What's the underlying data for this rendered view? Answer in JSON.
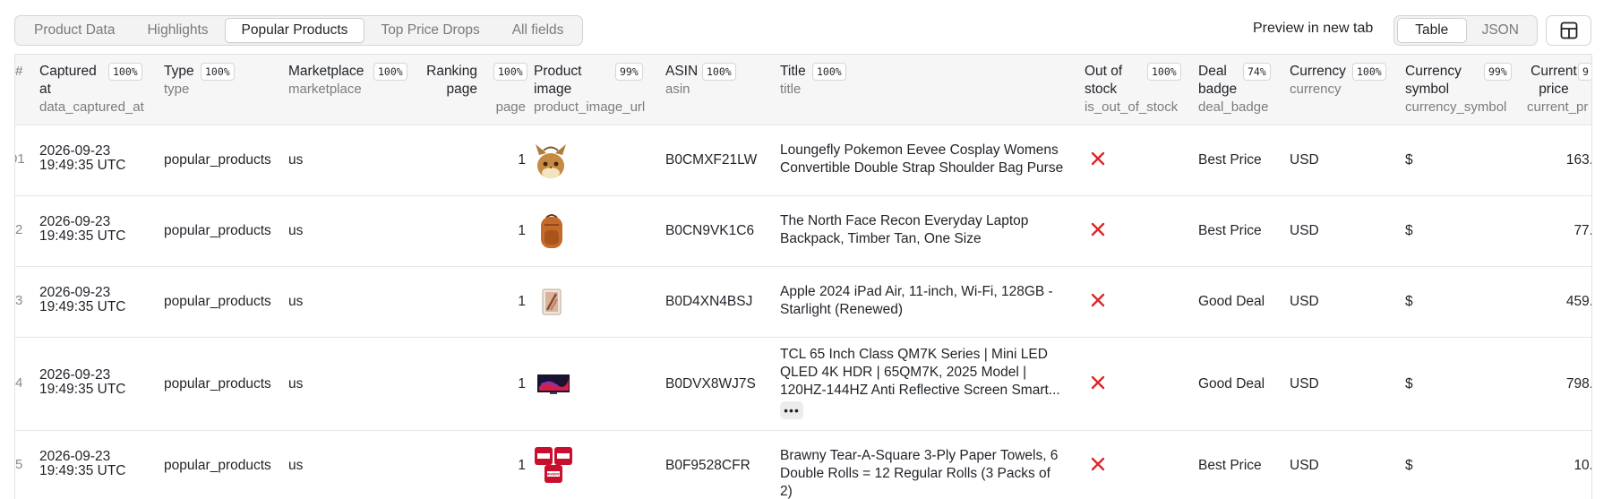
{
  "tabs": [
    {
      "label": "Product Data",
      "active": false
    },
    {
      "label": "Highlights",
      "active": false
    },
    {
      "label": "Popular Products",
      "active": true
    },
    {
      "label": "Top Price Drops",
      "active": false
    },
    {
      "label": "All fields",
      "active": false
    }
  ],
  "preview": {
    "label": "Preview in new tab"
  },
  "view_toggle": {
    "table": "Table",
    "json": "JSON",
    "active": "Table"
  },
  "layout_icon": "layout-panel-icon",
  "table": {
    "rownum_header": "#",
    "columns": [
      {
        "name": "Captured at",
        "key": "data_captured_at",
        "fill": "100%"
      },
      {
        "name": "Type",
        "key": "type",
        "fill": "100%"
      },
      {
        "name": "Marketplace",
        "key": "marketplace",
        "fill": "100%"
      },
      {
        "name": "Ranking page",
        "key": "page",
        "fill": "100%"
      },
      {
        "name": "Product image",
        "key": "product_image_url",
        "fill": "99%"
      },
      {
        "name": "ASIN",
        "key": "asin",
        "fill": "100%"
      },
      {
        "name": "Title",
        "key": "title",
        "fill": "100%"
      },
      {
        "name": "Out of stock",
        "key": "is_out_of_stock",
        "fill": "100%"
      },
      {
        "name": "Deal badge",
        "key": "deal_badge",
        "fill": "74%"
      },
      {
        "name": "Currency",
        "key": "currency",
        "fill": "100%"
      },
      {
        "name": "Currency symbol",
        "key": "currency_symbol",
        "fill": "99%"
      },
      {
        "name": "Current price",
        "key": "current_pr",
        "fill": "9"
      }
    ],
    "rows": [
      {
        "num": "01",
        "captured": "2026-09-23 19:49:35 UTC",
        "type": "popular_products",
        "marketplace": "us",
        "page": "1",
        "image": "eevee-bag-image",
        "asin": "B0CMXF21LW",
        "title": "Loungefly Pokemon Eevee Cosplay Womens Convertible Double Strap Shoulder Bag Purse",
        "out_of_stock": false,
        "deal": "Best Price",
        "currency": "USD",
        "symbol": "$",
        "price": "163."
      },
      {
        "num": "2",
        "captured": "2026-09-23 19:49:35 UTC",
        "type": "popular_products",
        "marketplace": "us",
        "page": "1",
        "image": "backpack-image",
        "asin": "B0CN9VK1C6",
        "title": "The North Face Recon Everyday Laptop Backpack, Timber Tan, One Size",
        "out_of_stock": false,
        "deal": "Best Price",
        "currency": "USD",
        "symbol": "$",
        "price": "77."
      },
      {
        "num": "3",
        "captured": "2026-09-23 19:49:35 UTC",
        "type": "popular_products",
        "marketplace": "us",
        "page": "1",
        "image": "ipad-image",
        "asin": "B0D4XN4BSJ",
        "title": "Apple 2024 iPad Air, 11-inch, Wi-Fi, 128GB - Starlight (Renewed)",
        "out_of_stock": false,
        "deal": "Good Deal",
        "currency": "USD",
        "symbol": "$",
        "price": "459."
      },
      {
        "num": "4",
        "captured": "2026-09-23 19:49:35 UTC",
        "type": "popular_products",
        "marketplace": "us",
        "page": "1",
        "image": "tv-image",
        "asin": "B0DVX8WJ7S",
        "title": "TCL 65 Inch Class QM7K Series | Mini LED QLED 4K HDR | 65QM7K, 2025 Model | 120HZ-144HZ Anti Reflective Screen Smart...",
        "title_more": "•••",
        "out_of_stock": false,
        "deal": "Good Deal",
        "currency": "USD",
        "symbol": "$",
        "price": "798."
      },
      {
        "num": "5",
        "captured": "2026-09-23 19:49:35 UTC",
        "type": "popular_products",
        "marketplace": "us",
        "page": "1",
        "image": "paper-towels-image",
        "asin": "B0F9528CFR",
        "title": "Brawny Tear-A-Square 3-Ply Paper Towels, 6 Double Rolls = 12 Regular Rolls (3 Packs of 2)",
        "out_of_stock": false,
        "deal": "Best Price",
        "currency": "USD",
        "symbol": "$",
        "price": "10."
      }
    ],
    "thumb_labels": {
      "paper_towels": "BRAWNY"
    }
  },
  "colors": {
    "x_mark": "#e02424",
    "border": "#e3e3e3",
    "header_bg": "#f6f6f6"
  }
}
